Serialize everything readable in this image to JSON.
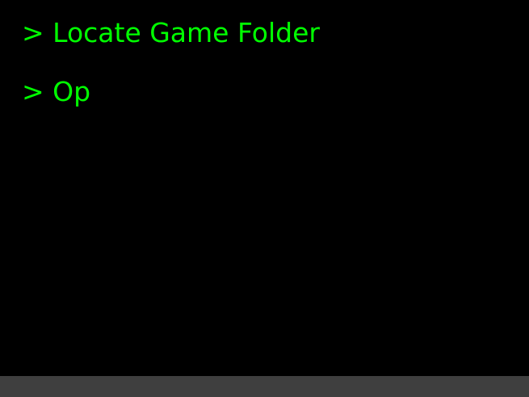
{
  "colors": {
    "text": "#00ff00",
    "background": "#000000",
    "bottom_bar": "#3f3f3f"
  },
  "menu": {
    "items": [
      {
        "label": "> Locate Game Folder"
      },
      {
        "label": "> Op"
      }
    ]
  }
}
